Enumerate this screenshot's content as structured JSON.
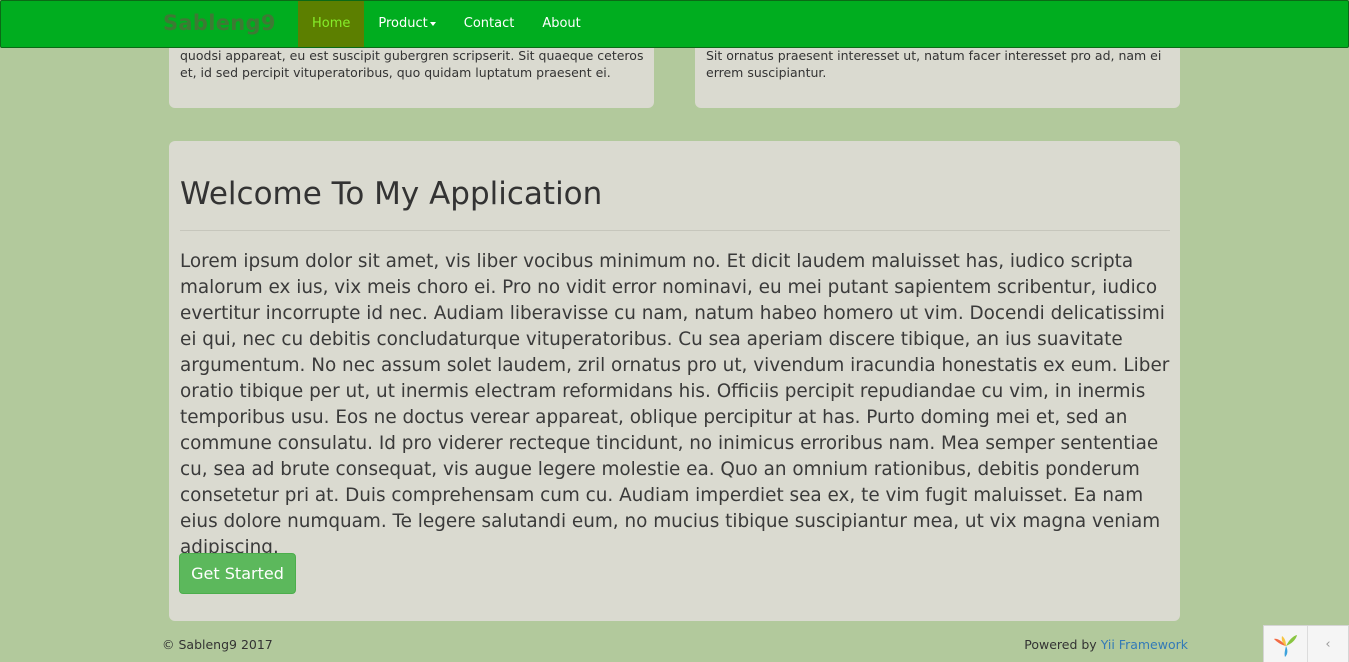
{
  "navbar": {
    "brand": "Sableng9",
    "items": [
      {
        "label": "Home",
        "active": true
      },
      {
        "label": "Product",
        "dropdown": true
      },
      {
        "label": "Contact"
      },
      {
        "label": "About"
      }
    ]
  },
  "top_cards": [
    {
      "text": "quodsi appareat, eu est suscipit gubergren scripserit. Sit quaeque ceteros et, id sed percipit vituperatoribus, quo quidam luptatum praesent ei."
    },
    {
      "text": "Sit ornatus praesent interesset ut, natum facer interesset pro ad, nam ei errem suscipiantur."
    }
  ],
  "jumbotron": {
    "title": "Welcome To My Application",
    "text": "Lorem ipsum dolor sit amet, vis liber vocibus minimum no. Et dicit laudem maluisset has, iudico scripta malorum ex ius, vix meis choro ei. Pro no vidit error nominavi, eu mei putant sapientem scribentur, iudico evertitur incorrupte id nec. Audiam liberavisse cu nam, natum habeo homero ut vim. Docendi delicatissimi ei qui, nec cu debitis concludaturque vituperatoribus. Cu sea aperiam discere tibique, an ius suavitate argumentum. No nec assum solet laudem, zril ornatus pro ut, vivendum iracundia honestatis ex eum. Liber oratio tibique per ut, ut inermis electram reformidans his. Officiis percipit repudiandae cu vim, in inermis temporibus usu. Eos ne doctus verear appareat, oblique percipitur at has. Purto doming mei et, sed an commune consulatu. Id pro viderer recteque tincidunt, no inimicus erroribus nam. Mea semper sententiae cu, sea ad brute consequat, vis augue legere molestie ea. Quo an omnium rationibus, debitis ponderum consetetur pri at. Duis comprehensam cum cu. Audiam imperdiet sea ex, te vim fugit maluisset. Ea nam eius dolore numquam. Te legere salutandi eum, no mucius tibique suscipiantur mea, ut vix magna veniam adipiscing.",
    "button_label": "Get Started"
  },
  "footer": {
    "copyright": "© Sableng9 2017",
    "powered_prefix": "Powered by ",
    "powered_link": "Yii Framework"
  },
  "debug_toolbar": {
    "logo_icon": "yii-logo-icon",
    "toggle_icon": "chevron-left-icon",
    "toggle_glyph": "‹"
  },
  "colors": {
    "page_background": "#b2c99c",
    "navbar": "#00ad1f",
    "navbar_active": "#5c7f00",
    "panel": "#dadad0",
    "button": "#5cb85c",
    "link": "#337ab7"
  }
}
